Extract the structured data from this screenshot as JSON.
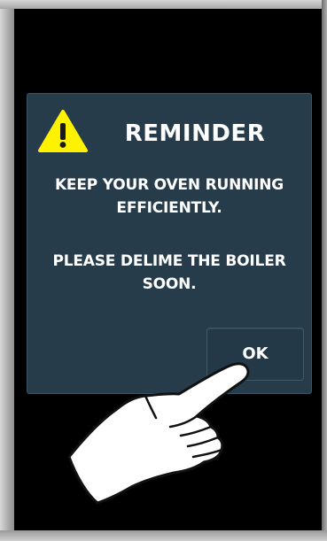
{
  "dialog": {
    "title": "REMINDER",
    "icon": "warning-icon",
    "message_line1": "KEEP YOUR OVEN RUNNING",
    "message_line2": "EFFICIENTLY.",
    "message_line3": "PLEASE DELIME THE BOILER",
    "message_line4": "SOON.",
    "ok_label": "OK"
  },
  "colors": {
    "screen_background": "#000000",
    "dialog_background": "#263c4b",
    "warning_yellow": "#fff200",
    "text": "#ffffff"
  }
}
